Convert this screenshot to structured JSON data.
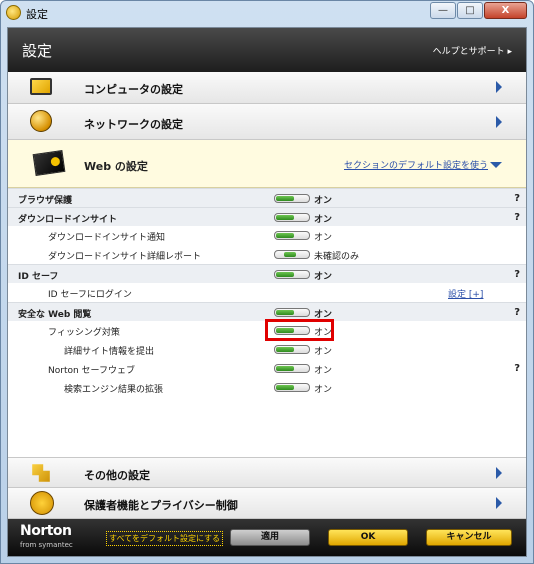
{
  "window": {
    "title": "設定",
    "min_btn": "—",
    "max_btn": "□",
    "close_btn": "X"
  },
  "header": {
    "title": "設定",
    "help_link": "ヘルプとサポート ▸"
  },
  "categories": {
    "computer": "コンピュータの設定",
    "network": "ネットワークの設定",
    "other": "その他の設定",
    "parental": "保護者機能とプライバシー制御"
  },
  "web": {
    "label": "Web の設定",
    "defaults_link": "セクションのデフォルト設定を使う"
  },
  "rows": [
    {
      "label": "ブラウザ保護",
      "value": "オン",
      "help": "?"
    },
    {
      "label": "ダウンロードインサイト",
      "value": "オン",
      "help": "?"
    },
    {
      "label": "ダウンロードインサイト通知",
      "value": "オン"
    },
    {
      "label": "ダウンロードインサイト詳細レポート",
      "value": "未確認のみ"
    },
    {
      "label": "ID セーフ",
      "value": "オン",
      "help": "?"
    },
    {
      "label": "ID セーフにログイン",
      "link": "設定 [+]"
    },
    {
      "label": "安全な Web 閲覧",
      "value": "オン",
      "help": "?"
    },
    {
      "label": "フィッシング対策",
      "value": "オン"
    },
    {
      "label": "詳細サイト情報を提出",
      "value": "オン"
    },
    {
      "label": "Norton セーフウェブ",
      "value": "オン",
      "help": "?"
    },
    {
      "label": "検索エンジン結果の拡張",
      "value": "オン"
    }
  ],
  "footer": {
    "logo": "Norton",
    "logo_sub": "from symantec",
    "defaults_link": "すべてをデフォルト設定にする",
    "apply": "適用",
    "ok": "OK",
    "cancel": "キャンセル"
  },
  "icons": [
    "monitor-icon",
    "globe-icon",
    "card-icon",
    "tool-icon",
    "family-icon",
    "help-icon"
  ]
}
